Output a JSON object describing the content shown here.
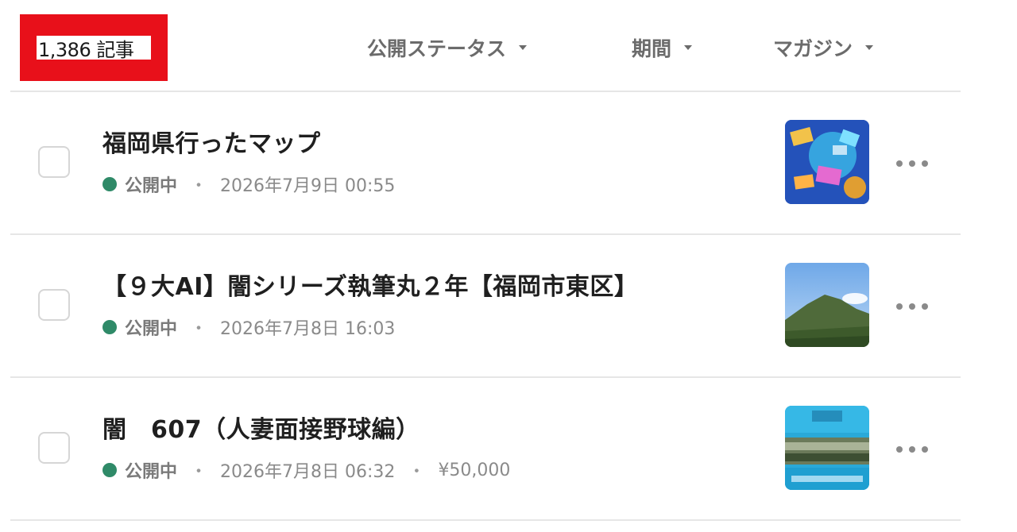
{
  "header": {
    "article_count": "1,386 記事",
    "filters": [
      {
        "label": "公開ステータス"
      },
      {
        "label": "期間"
      },
      {
        "label": "マガジン"
      }
    ]
  },
  "articles": [
    {
      "title": "福岡県行ったマップ",
      "status": "公開中",
      "separator": "・",
      "date": "2026年7月9日 00:55",
      "price": "",
      "status_color": "#2f8a68"
    },
    {
      "title": "【９大AI】闇シリーズ執筆丸２年【福岡市東区】",
      "status": "公開中",
      "separator": "・",
      "date": "2026年7月8日 16:03",
      "price": "",
      "status_color": "#2f8a68"
    },
    {
      "title": "闇　607（人妻面接野球編）",
      "status": "公開中",
      "separator": "・",
      "date": "2026年7月8日 06:32",
      "price": "¥50,000",
      "status_color": "#2f8a68"
    }
  ],
  "icons": {
    "filter_caret": "chevron-down-icon",
    "more": "more-horizontal-icon",
    "status": "status-dot-icon"
  },
  "colors": {
    "highlight_box": "#e8101a",
    "status_published": "#2f8a68"
  }
}
